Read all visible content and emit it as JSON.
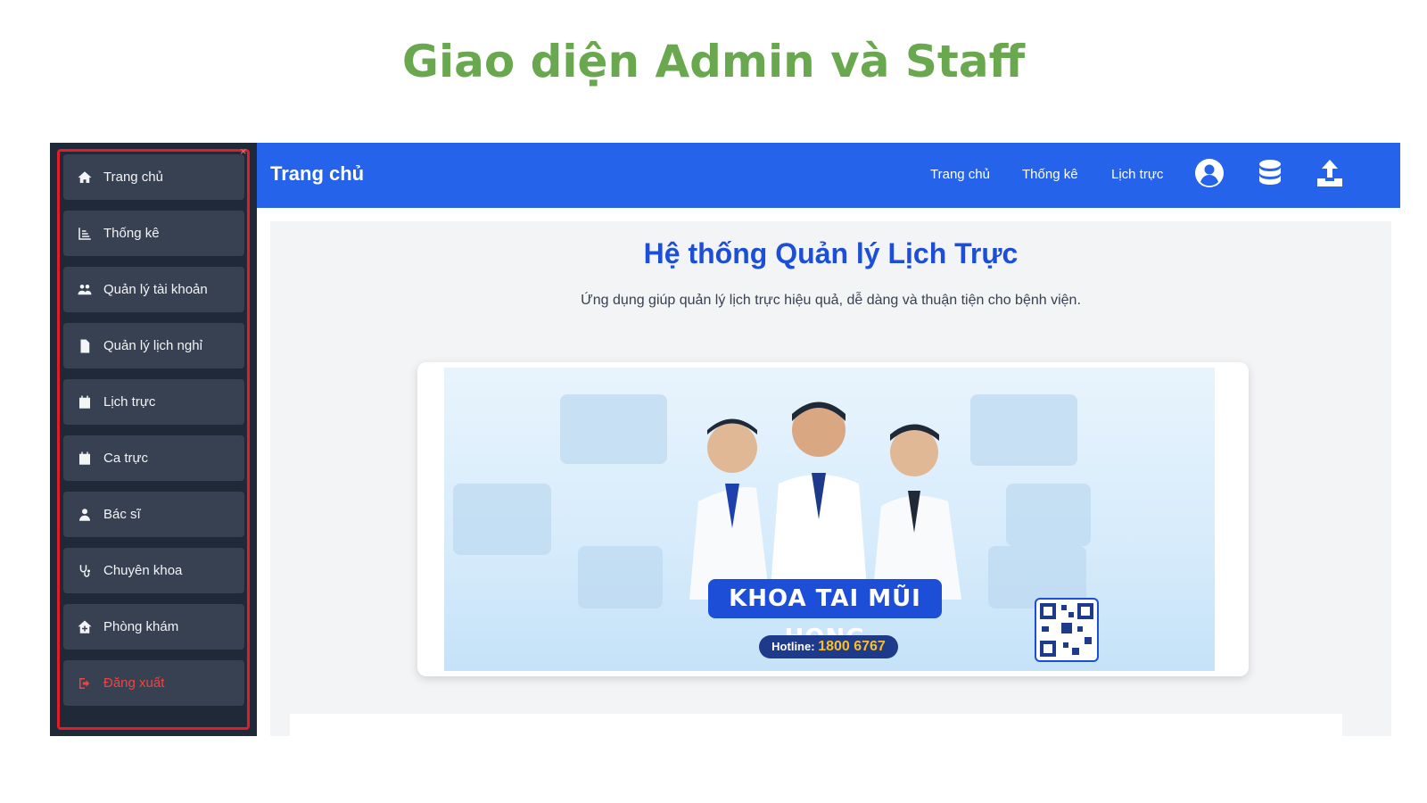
{
  "slide": {
    "title": "Giao diện Admin và Staff"
  },
  "sidebar": {
    "items": [
      {
        "label": "Trang chủ",
        "icon": "home-icon"
      },
      {
        "label": "Thống kê",
        "icon": "chart-icon"
      },
      {
        "label": "Quản lý tài khoản",
        "icon": "users-icon"
      },
      {
        "label": "Quản lý lịch nghỉ",
        "icon": "file-icon"
      },
      {
        "label": "Lịch trực",
        "icon": "calendar-icon"
      },
      {
        "label": "Ca trực",
        "icon": "calendar-day-icon"
      },
      {
        "label": "Bác sĩ",
        "icon": "doctor-icon"
      },
      {
        "label": "Chuyên khoa",
        "icon": "stethoscope-icon"
      },
      {
        "label": "Phòng khám",
        "icon": "clinic-icon"
      }
    ],
    "logout_label": "Đăng xuất",
    "close_glyph": "×"
  },
  "topbar": {
    "title": "Trang chủ",
    "nav": [
      "Trang chủ",
      "Thống kê",
      "Lịch trực"
    ],
    "icons": [
      "user-circle-icon",
      "database-icon",
      "upload-icon"
    ]
  },
  "hero": {
    "title": "Hệ thống Quản lý Lịch Trực",
    "subtitle": "Ứng dụng giúp quản lý lịch trực hiệu quả, dễ dàng và thuận tiện cho bệnh viện."
  },
  "carousel": {
    "prev": "‹",
    "next": "›",
    "banner_label": "KHOA TAI MŨI HỌNG",
    "hotline_label": "Hotline:",
    "hotline_number": "1800 6767"
  },
  "colors": {
    "topbar": "#2563eb",
    "sidebar": "#1f2937",
    "title_green": "#6aa84f",
    "highlight": "#e11d2a"
  }
}
